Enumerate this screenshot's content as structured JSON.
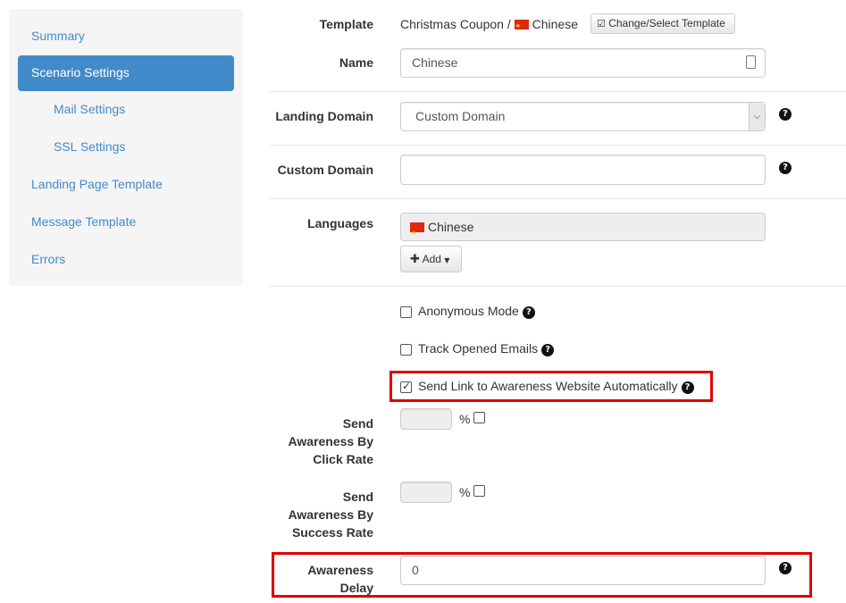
{
  "sidebar": {
    "summary": "Summary",
    "scenario_settings": "Scenario Settings",
    "mail_settings": "Mail Settings",
    "ssl_settings": "SSL Settings",
    "landing_page_template": "Landing Page Template",
    "message_template": "Message Template",
    "errors": "Errors"
  },
  "form": {
    "template": {
      "label": "Template",
      "value": "Christmas Coupon /",
      "language": "Chinese",
      "button": "Change/Select Template"
    },
    "name": {
      "label": "Name",
      "value": "Chinese"
    },
    "landing_domain": {
      "label": "Landing Domain",
      "value": "Custom Domain"
    },
    "custom_domain": {
      "label": "Custom Domain",
      "value": ""
    },
    "languages": {
      "label": "Languages",
      "items": [
        "Chinese"
      ],
      "add_button": "Add"
    },
    "options": {
      "anonymous_mode": {
        "label": "Anonymous Mode",
        "checked": false
      },
      "track_opened_emails": {
        "label": "Track Opened Emails",
        "checked": false
      },
      "send_link_awareness": {
        "label": "Send Link to Awareness Website Automatically",
        "checked": true
      }
    },
    "send_by_click_rate": {
      "label_line1": "Send",
      "label_line2": "Awareness By",
      "label_line3": "Click Rate",
      "unit": "%"
    },
    "send_by_success_rate": {
      "label_line1": "Send",
      "label_line2": "Awareness By",
      "label_line3": "Success Rate",
      "unit": "%"
    },
    "awareness_delay": {
      "label_line1": "Awareness",
      "label_line2": "Delay",
      "value": "0"
    }
  },
  "colors": {
    "accent": "#428bca",
    "highlight": "#e00000",
    "sidebar_bg": "#f5f5f5"
  }
}
